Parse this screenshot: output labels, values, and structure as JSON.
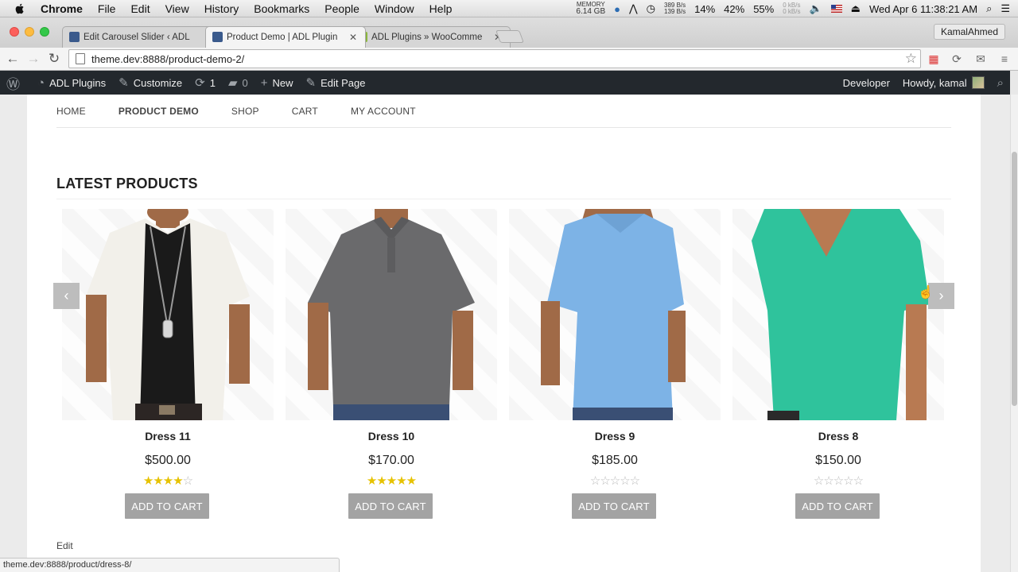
{
  "menubar": {
    "items": [
      "Chrome",
      "File",
      "Edit",
      "View",
      "History",
      "Bookmarks",
      "People",
      "Window",
      "Help"
    ],
    "memory_label": "MEMORY",
    "memory_value": "6.14 GB",
    "net_up": "389 B/s",
    "net_down": "139 B/s",
    "cpu": "14%",
    "battery1": "42%",
    "battery2": "55%",
    "net2_up": "0 kB/s",
    "net2_down": "0 kB/s",
    "datetime": "Wed Apr 6  11:38:21 AM"
  },
  "tabs": [
    {
      "title": "Edit Carousel Slider ‹ ADL",
      "favicon_color": "#3a5a8c"
    },
    {
      "title": "Product Demo | ADL Plugin",
      "favicon_color": "#3a5a8c"
    },
    {
      "title": "ADL Plugins » WooComme",
      "favicon_color": "#8ab53c"
    }
  ],
  "profile": "KamalAhmed",
  "url": "theme.dev:8888/product-demo-2/",
  "adminbar": {
    "site": "ADL Plugins",
    "customize": "Customize",
    "updates": "1",
    "comments": "0",
    "new": "New",
    "edit_page": "Edit Page",
    "developer": "Developer",
    "howdy": "Howdy, kamal"
  },
  "site_nav": [
    "HOME",
    "PRODUCT DEMO",
    "SHOP",
    "CART",
    "MY ACCOUNT"
  ],
  "section_title": "LATEST PRODUCTS",
  "products": [
    {
      "name": "Dress 11",
      "price": "$500.00",
      "rating": 4,
      "button": "ADD TO CART"
    },
    {
      "name": "Dress 10",
      "price": "$170.00",
      "rating": 5,
      "button": "ADD TO CART"
    },
    {
      "name": "Dress 9",
      "price": "$185.00",
      "rating": 0,
      "button": "ADD TO CART"
    },
    {
      "name": "Dress 8",
      "price": "$150.00",
      "rating": 0,
      "button": "ADD TO CART"
    }
  ],
  "edit_link": "Edit",
  "status_url": "theme.dev:8888/product/dress-8/",
  "colors": {
    "adminbar": "#23282d",
    "button": "#a3a3a3",
    "star": "#e6c200"
  }
}
